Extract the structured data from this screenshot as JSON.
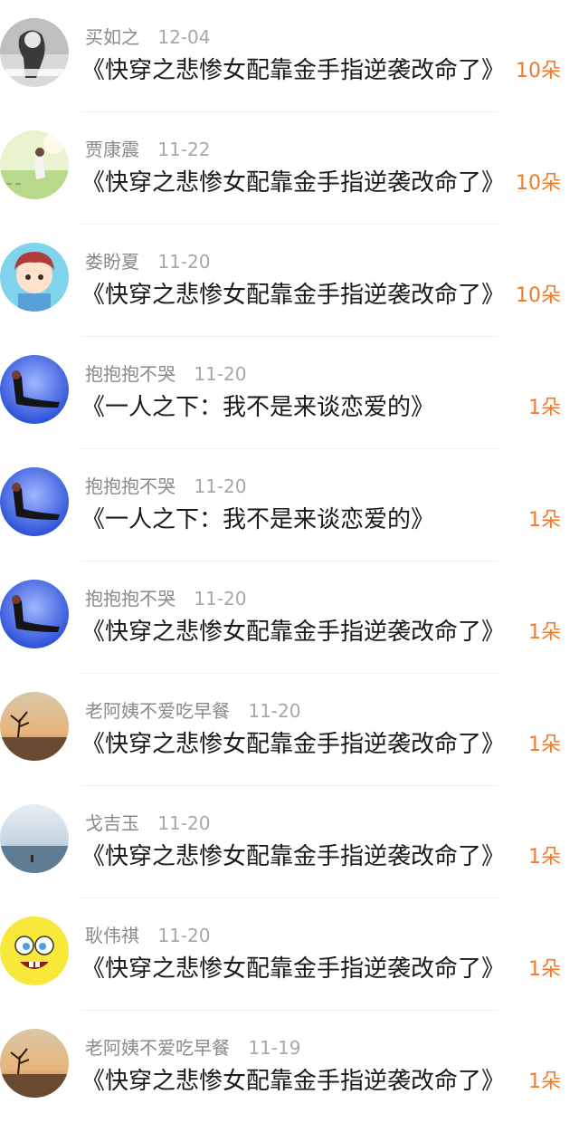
{
  "gift_list": [
    {
      "user": "买如之",
      "date": "12-04",
      "book": "《快穿之悲惨女配靠金手指逆袭改命了》",
      "count": "10朵",
      "avatar_icon": "bw-girl-photo-avatar"
    },
    {
      "user": "贾康震",
      "date": "11-22",
      "book": "《快穿之悲惨女配靠金手指逆袭改命了》",
      "count": "10朵",
      "avatar_icon": "meadow-girl-avatar"
    },
    {
      "user": "娄盼夏",
      "date": "11-20",
      "book": "《快穿之悲惨女配靠金手指逆袭改命了》",
      "count": "10朵",
      "avatar_icon": "cartoon-boy-avatar"
    },
    {
      "user": "抱抱抱不哭",
      "date": "11-20",
      "book": "《一人之下：我不是来谈恋爱的》",
      "count": "1朵",
      "avatar_icon": "blue-woman-avatar"
    },
    {
      "user": "抱抱抱不哭",
      "date": "11-20",
      "book": "《一人之下：我不是来谈恋爱的》",
      "count": "1朵",
      "avatar_icon": "blue-woman-avatar"
    },
    {
      "user": "抱抱抱不哭",
      "date": "11-20",
      "book": "《快穿之悲惨女配靠金手指逆袭改命了》",
      "count": "1朵",
      "avatar_icon": "blue-woman-avatar"
    },
    {
      "user": "老阿姨不爱吃早餐",
      "date": "11-20",
      "book": "《快穿之悲惨女配靠金手指逆袭改命了》",
      "count": "1朵",
      "avatar_icon": "sunset-tree-avatar"
    },
    {
      "user": "戈吉玉",
      "date": "11-20",
      "book": "《快穿之悲惨女配靠金手指逆袭改命了》",
      "count": "1朵",
      "avatar_icon": "lake-sky-avatar"
    },
    {
      "user": "耿伟祺",
      "date": "11-20",
      "book": "《快穿之悲惨女配靠金手指逆袭改命了》",
      "count": "1朵",
      "avatar_icon": "sponge-character-avatar"
    },
    {
      "user": "老阿姨不爱吃早餐",
      "date": "11-19",
      "book": "《快穿之悲惨女配靠金手指逆袭改命了》",
      "count": "1朵",
      "avatar_icon": "sunset-tree-avatar"
    }
  ],
  "colors": {
    "count_accent": "#f07a2a",
    "meta_text": "#8a8a8a",
    "title_text": "#1a1a1a"
  }
}
